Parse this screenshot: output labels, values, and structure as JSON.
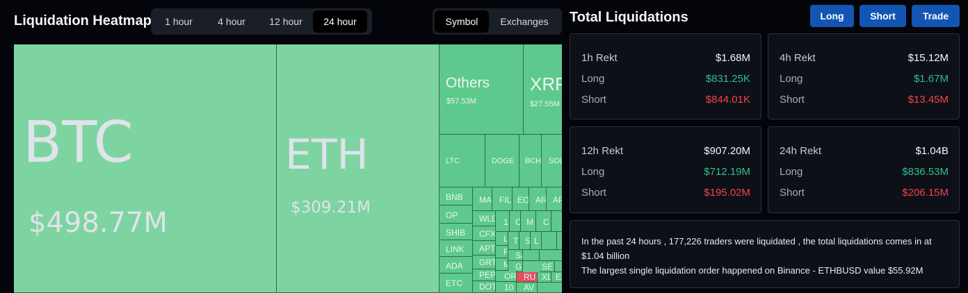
{
  "header": {
    "title": "Liquidation Heatmap",
    "time_options": [
      "1 hour",
      "4 hour",
      "12 hour",
      "24 hour"
    ],
    "selected_time": "24 hour",
    "view_options": [
      "Symbol",
      "Exchanges"
    ],
    "selected_view": "Symbol"
  },
  "heatmap": {
    "btc": {
      "symbol": "BTC",
      "value": "$498.77M"
    },
    "eth": {
      "symbol": "ETH",
      "value": "$309.21M"
    },
    "others": {
      "symbol": "Others",
      "value": "$57.53M"
    },
    "xrp": {
      "symbol": "XRP",
      "value": "$27.55M"
    },
    "mid": [
      "LTC",
      "DOGE",
      "BCH",
      "SOL"
    ],
    "col1": [
      "BNB",
      "OP",
      "SHIB",
      "LINK",
      "ADA",
      "ETC"
    ],
    "col2": [
      "MA",
      "WLD",
      "CFX",
      "APT",
      "GRT",
      "PEPE",
      "DOT"
    ],
    "small": [
      "FIL",
      "EO",
      "AR",
      "AP",
      "1",
      "C",
      "M",
      "C",
      "LD",
      "T",
      "S",
      "L",
      "FT",
      "SA",
      "GA",
      "SE",
      "MK",
      "OR",
      "RU",
      "XL",
      "E",
      "10",
      "AV"
    ]
  },
  "right": {
    "title": "Total Liquidations",
    "buttons": {
      "long": "Long",
      "short": "Short",
      "trade": "Trade"
    },
    "cards": [
      {
        "period": "1h Rekt",
        "total": "$1.68M",
        "long_label": "Long",
        "long": "$831.25K",
        "short_label": "Short",
        "short": "$844.01K"
      },
      {
        "period": "4h Rekt",
        "total": "$15.12M",
        "long_label": "Long",
        "long": "$1.67M",
        "short_label": "Short",
        "short": "$13.45M"
      },
      {
        "period": "12h Rekt",
        "total": "$907.20M",
        "long_label": "Long",
        "long": "$712.19M",
        "short_label": "Short",
        "short": "$195.02M"
      },
      {
        "period": "24h Rekt",
        "total": "$1.04B",
        "long_label": "Long",
        "long": "$836.53M",
        "short_label": "Short",
        "short": "$206.15M"
      }
    ],
    "summary": {
      "line1": "In the past 24 hours , 177,226 traders were liquidated , the total liquidations comes in at $1.04 billion",
      "line2": "The largest single liquidation order happened on Binance - ETHBUSD value $55.92M"
    }
  },
  "colors": {
    "long": "#2fbf8f",
    "short": "#f0434e",
    "accent": "#1355b3",
    "tile": "#5ec98c"
  }
}
